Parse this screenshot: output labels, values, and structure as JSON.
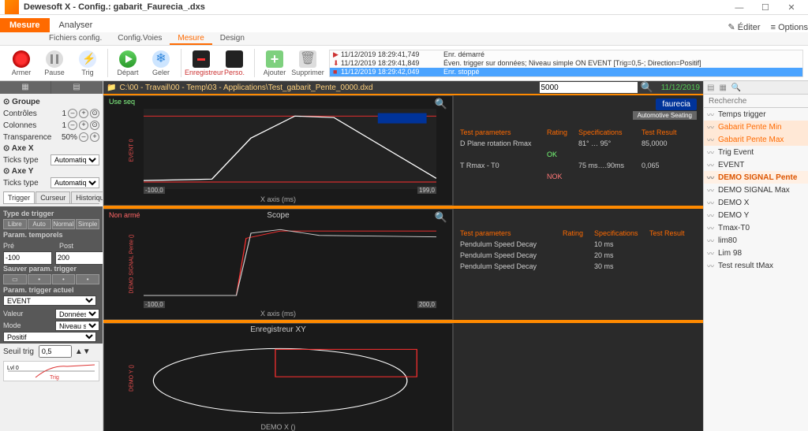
{
  "window": {
    "title": "Dewesoft X - Config.: gabarit_Faurecia_.dxs"
  },
  "main_tabs": {
    "measure": "Mesure",
    "analyse": "Analyser",
    "right_edit": "Éditer",
    "right_opts": "Options"
  },
  "sub_tabs": {
    "files": "Fichiers config.",
    "voies": "Config.Voies",
    "mesure": "Mesure",
    "design": "Design"
  },
  "toolbar": {
    "armer": "Armer",
    "pause": "Pause",
    "trig": "Trig",
    "depart": "Départ",
    "geler": "Geler",
    "enreg": "Enregistreur",
    "perso": "Perso.",
    "ajouter": "Ajouter",
    "supprimer": "Supprimer"
  },
  "events": [
    {
      "ts": "11/12/2019 18:29:41,749",
      "msg": "Enr. démarré"
    },
    {
      "ts": "11/12/2019 18:29:41,849",
      "msg": "Éven. trigger sur données; Niveau simple ON EVENT [Trig=0,5-; Direction=Positif]"
    },
    {
      "ts": "11/12/2019 18:29:42,049",
      "msg": "Enr. stoppé"
    }
  ],
  "path": "C:\\00 - Travail\\00 - Temp\\03 - Applications\\Test_gabarit_Pente_0000.dxd",
  "path_val": "5000",
  "date": "11/12/2019",
  "left": {
    "groupe": "Groupe",
    "controles": "Contrôles",
    "controles_v": "1",
    "colonnes": "Colonnes",
    "colonnes_v": "1",
    "transp": "Transparence",
    "transp_v": "50%",
    "axex": "Axe X",
    "axey": "Axe Y",
    "ticks": "Ticks type",
    "ticks_v": "Automatique",
    "tabs": {
      "trigger": "Trigger",
      "curseur": "Curseur",
      "histo": "Historique"
    },
    "type_trig": "Type de trigger",
    "t1": "Libre",
    "t2": "Auto",
    "t3": "Normal",
    "t4": "Simple",
    "param_temp": "Param. temporels",
    "pre": "Pré",
    "pre_v": "-100",
    "post": "Post",
    "post_v": "200",
    "sauver": "Sauver param. trigger",
    "param_act": "Param. trigger actuel",
    "event_v": "EVENT",
    "valeur": "Valeur",
    "valeur_v": "Données Réell",
    "mode": "Mode",
    "mode_v": "Niveau simple",
    "positif": "Positif",
    "seuil": "Seuil trig",
    "seuil_v": "0,5",
    "lvl": "Lvl 0",
    "trig2": "Trig"
  },
  "chart1": {
    "status": "Use seq",
    "brand": "faurecia",
    "brand2": "Automotive Seating",
    "xlab": "X axis (ms)",
    "xmin": "-100,0",
    "xmax": "199,0"
  },
  "chart2": {
    "status": "Non armé",
    "title": "Scope",
    "xlab": "X axis (ms)",
    "xmin": "-100,0",
    "xmax": "200,0",
    "ylab": "DEMO SIGNAL Pente ()"
  },
  "chart3": {
    "title": "Enregistreur XY",
    "xlab": "DEMO X ()",
    "ylab": "DEMO Y ()"
  },
  "info1": {
    "h1": "Test parameters",
    "h2": "Rating",
    "h3": "Specifications",
    "h4": "Test Result",
    "r1": "D Plane rotation Rmax",
    "r1r": "OK",
    "r1s": "81° …  95°",
    "r1v": "85,0000",
    "r2": "T Rmax - T0",
    "r2r": "NOK",
    "r2s": "75 ms….90ms",
    "r2v": "0,065"
  },
  "info2": {
    "h1": "Test parameters",
    "h2": "Rating",
    "h3": "Specifications",
    "h4": "Test Result",
    "r1": "Pendulum Speed Decay",
    "r1s": "10 ms",
    "r2": "Pendulum Speed Decay",
    "r2s": "20 ms",
    "r3": "Pendulum Speed Decay",
    "r3s": "30 ms"
  },
  "right": {
    "search_ph": "Recherche",
    "items": [
      {
        "n": "Temps trigger"
      },
      {
        "n": "Gabarit Pente Min",
        "sel": 1
      },
      {
        "n": "Gabarit Pente Max",
        "sel": 1
      },
      {
        "n": "Trig Event"
      },
      {
        "n": "EVENT"
      },
      {
        "n": "DEMO SIGNAL Pente",
        "hl": 1
      },
      {
        "n": "DEMO SIGNAL Max"
      },
      {
        "n": "DEMO X"
      },
      {
        "n": "DEMO Y"
      },
      {
        "n": "Tmax-T0"
      },
      {
        "n": "lim80"
      },
      {
        "n": "Lim 98"
      },
      {
        "n": "Test result tMax"
      }
    ]
  },
  "chart_data": [
    {
      "type": "line",
      "title": "",
      "xlabel": "X axis (ms)",
      "ylabel": "",
      "xlim": [
        -100,
        199
      ],
      "series": [
        {
          "name": "template-upper",
          "color": "#ff3030",
          "x": [
            -100,
            -40,
            80,
            199
          ],
          "y": [
            100,
            100,
            100,
            100
          ]
        },
        {
          "name": "template-lower",
          "color": "#ff3030",
          "x": [
            -100,
            -40,
            80,
            199
          ],
          "y": [
            0,
            0,
            0,
            0
          ]
        },
        {
          "name": "signal",
          "color": "#ffffff",
          "x": [
            -100,
            -30,
            0,
            40,
            80,
            199
          ],
          "y": [
            6,
            10,
            70,
            100,
            98,
            8
          ]
        }
      ]
    },
    {
      "type": "line",
      "title": "Scope",
      "xlabel": "X axis (ms)",
      "ylabel": "DEMO SIGNAL Pente ()",
      "xlim": [
        -100,
        200
      ],
      "series": [
        {
          "name": "gabarit",
          "color": "#ff3030",
          "x": [
            -100,
            -20,
            -10,
            30,
            60,
            200
          ],
          "y": [
            0,
            0,
            0.9,
            1.0,
            1.0,
            1.0
          ]
        },
        {
          "name": "signal",
          "color": "#cccccc",
          "x": [
            -100,
            -20,
            -5,
            30,
            60,
            200
          ],
          "y": [
            0,
            0,
            0.95,
            1.02,
            0.96,
            0.94
          ]
        }
      ]
    },
    {
      "type": "line",
      "title": "Enregistreur XY",
      "xlabel": "DEMO X ()",
      "ylabel": "DEMO Y ()",
      "series": [
        {
          "name": "ellipse",
          "color": "#ffffff"
        },
        {
          "name": "box",
          "color": "#ff3030"
        }
      ]
    }
  ]
}
